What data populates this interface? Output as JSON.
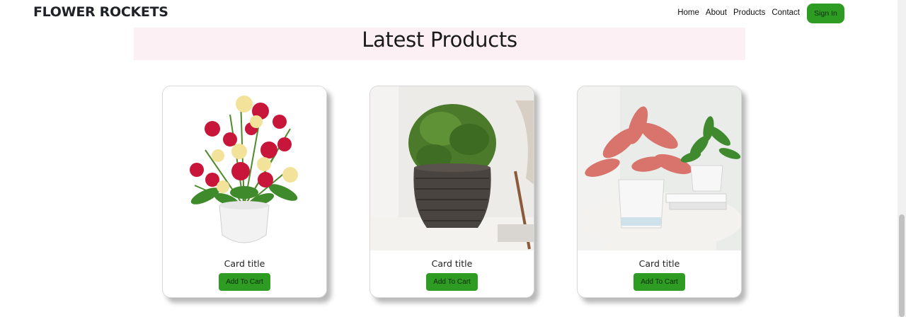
{
  "navbar": {
    "brand": "FLOWER ROCKETS",
    "links": [
      "Home",
      "About",
      "Products",
      "Contact"
    ],
    "signin_label": "Sign In"
  },
  "section": {
    "title": "Latest Products"
  },
  "cards": [
    {
      "title": "Card title",
      "button": "Add To Cart",
      "image": "flower-bouquet-pot"
    },
    {
      "title": "Card title",
      "button": "Add To Cart",
      "image": "bush-wicker-basket"
    },
    {
      "title": "Card title",
      "button": "Add To Cart",
      "image": "potted-plants-table"
    }
  ],
  "colors": {
    "accent": "#2e9b22",
    "hero_bg": "#fdf0f4"
  }
}
